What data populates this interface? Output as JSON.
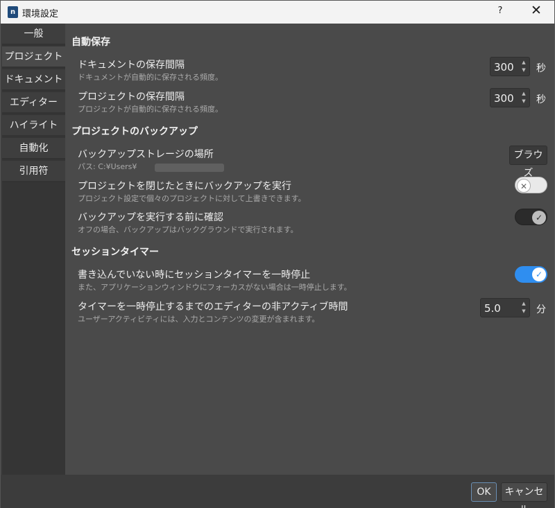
{
  "window": {
    "title": "環境設定",
    "help": "?",
    "close": "✕"
  },
  "sidebar": {
    "items": [
      {
        "label": "一般"
      },
      {
        "label": "プロジェクト"
      },
      {
        "label": "ドキュメント"
      },
      {
        "label": "エディター"
      },
      {
        "label": "ハイライト"
      },
      {
        "label": "自動化"
      },
      {
        "label": "引用符"
      }
    ],
    "active": "プロジェクト"
  },
  "autosave": {
    "title": "自動保存",
    "document": {
      "label": "ドキュメントの保存間隔",
      "desc": "ドキュメントが自動的に保存される頻度。",
      "value": "300",
      "unit": "秒"
    },
    "project": {
      "label": "プロジェクトの保存間隔",
      "desc": "プロジェクトが自動的に保存される頻度。",
      "value": "300",
      "unit": "秒"
    }
  },
  "backup": {
    "title": "プロジェクトのバックアップ",
    "storage": {
      "label": "バックアップストレージの場所",
      "desc": "パス: C:¥Users¥",
      "button": "ブラウズ"
    },
    "on_close": {
      "label": "プロジェクトを閉じたときにバックアップを実行",
      "desc": "プロジェクト設定で個々のプロジェクトに対して上書きできます。",
      "enabled": false
    },
    "confirm": {
      "label": "バックアップを実行する前に確認",
      "desc": "オフの場合、バックアップはバックグラウンドで実行されます。",
      "enabled": true
    }
  },
  "session": {
    "title": "セッションタイマー",
    "pause": {
      "label": "書き込んでいない時にセッションタイマーを一時停止",
      "desc": "また、アプリケーションウィンドウにフォーカスがない場合は一時停止します。",
      "enabled": true
    },
    "inactive": {
      "label": "タイマーを一時停止するまでのエディターの非アクティブ時間",
      "desc": "ユーザーアクティビティには、入力とコンテンツの変更が含まれます。",
      "value": "5.0",
      "unit": "分"
    }
  },
  "footer": {
    "ok": "OK",
    "cancel": "キャンセル"
  },
  "icons": {
    "toggle_off": "close-icon",
    "toggle_on": "check-icon"
  },
  "colors": {
    "toggle_on_accent": "#2f8ef0",
    "toggle_confirm_on": "#2b2b2b",
    "toggle_off_bg": "#e9e9e9"
  }
}
